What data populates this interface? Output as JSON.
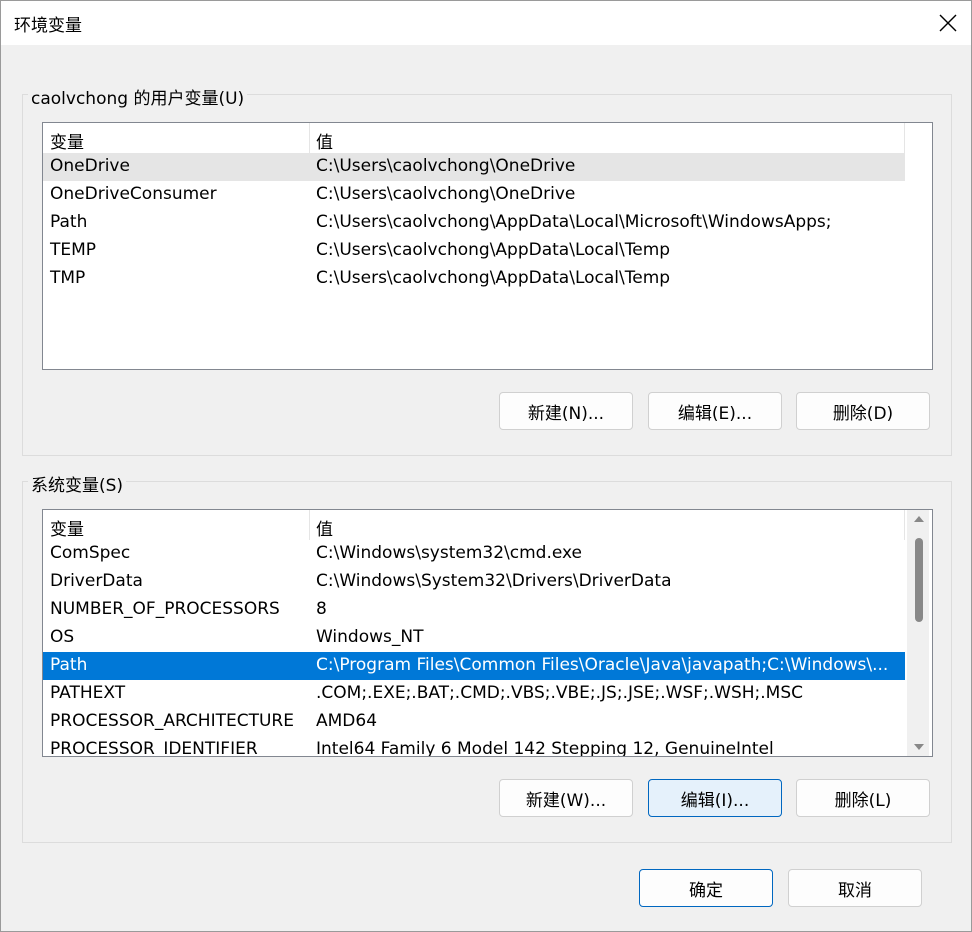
{
  "window": {
    "title": "环境变量"
  },
  "user_vars": {
    "group_label": "caolvchong 的用户变量(U)",
    "col_var": "变量",
    "col_val": "值",
    "rows": [
      {
        "name": "OneDrive",
        "value": "C:\\Users\\caolvchong\\OneDrive"
      },
      {
        "name": "OneDriveConsumer",
        "value": "C:\\Users\\caolvchong\\OneDrive"
      },
      {
        "name": "Path",
        "value": "C:\\Users\\caolvchong\\AppData\\Local\\Microsoft\\WindowsApps;"
      },
      {
        "name": "TEMP",
        "value": "C:\\Users\\caolvchong\\AppData\\Local\\Temp"
      },
      {
        "name": "TMP",
        "value": "C:\\Users\\caolvchong\\AppData\\Local\\Temp"
      }
    ],
    "new_label": "新建(N)...",
    "edit_label": "编辑(E)...",
    "delete_label": "删除(D)"
  },
  "system_vars": {
    "group_label": "系统变量(S)",
    "col_var": "变量",
    "col_val": "值",
    "rows": [
      {
        "name": "ComSpec",
        "value": "C:\\Windows\\system32\\cmd.exe"
      },
      {
        "name": "DriverData",
        "value": "C:\\Windows\\System32\\Drivers\\DriverData"
      },
      {
        "name": "NUMBER_OF_PROCESSORS",
        "value": "8"
      },
      {
        "name": "OS",
        "value": "Windows_NT"
      },
      {
        "name": "Path",
        "value": "C:\\Program Files\\Common Files\\Oracle\\Java\\javapath;C:\\Windows\\..."
      },
      {
        "name": "PATHEXT",
        "value": ".COM;.EXE;.BAT;.CMD;.VBS;.VBE;.JS;.JSE;.WSF;.WSH;.MSC"
      },
      {
        "name": "PROCESSOR_ARCHITECTURE",
        "value": "AMD64"
      },
      {
        "name": "PROCESSOR_IDENTIFIER",
        "value": "Intel64 Family 6 Model 142 Stepping 12, GenuineIntel"
      }
    ],
    "new_label": "新建(W)...",
    "edit_label": "编辑(I)...",
    "delete_label": "删除(L)"
  },
  "footer": {
    "ok_label": "确定",
    "cancel_label": "取消"
  },
  "colors": {
    "selection": "#0078d7",
    "hover_row": "#e5e5e5",
    "accent_border": "#0067c0"
  }
}
